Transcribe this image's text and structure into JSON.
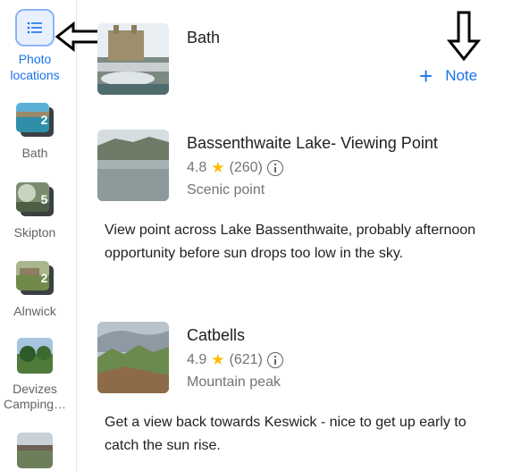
{
  "sidebar": {
    "toggle_label": "Photo locations",
    "toggle_line1": "Photo",
    "toggle_line2": "locations",
    "items": [
      {
        "label": "Bath",
        "count": "2"
      },
      {
        "label": "Skipton",
        "count": "5"
      },
      {
        "label": "Alnwick",
        "count": "2"
      },
      {
        "label": "Devizes Camping…",
        "line1": "Devizes",
        "line2": "Camping…"
      },
      {
        "label": ""
      }
    ]
  },
  "main": {
    "list_title": "Bath",
    "add_note_label": "Note",
    "places": [
      {
        "name": "Bassenthwaite Lake- Viewing Point",
        "rating": "4.8",
        "reviews": "(260)",
        "category": "Scenic point",
        "note": "View point across Lake Bassenthwaite, probably afternoon opportunity before sun drops too low in the sky."
      },
      {
        "name": "Catbells",
        "rating": "4.9",
        "reviews": "(621)",
        "category": "Mountain peak",
        "note": "Get a view back towards Keswick - nice to get up early to catch the sun rise."
      }
    ]
  },
  "colors": {
    "accent": "#1a73e8",
    "star": "#fbbc04",
    "muted": "#70757a"
  }
}
